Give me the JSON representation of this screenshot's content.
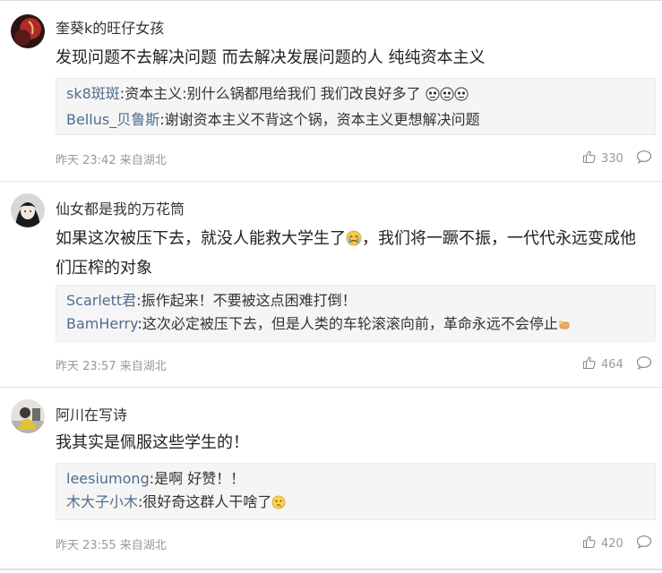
{
  "comments": [
    {
      "username": "奎葵k的旺仔女孩",
      "avatar_icon": "avatar-dark-red",
      "content": "发现问题不去解决问题 而去解决发展问题的人 纯纯资本主义",
      "replies": [
        {
          "user": "sk8斑斑",
          "sep": ":",
          "text": "资本主义:别什么锅都甩给我们 我们改良好多了",
          "emoji": [
            "disapproval-face-icon",
            "disapproval-face-icon",
            "disapproval-face-icon"
          ]
        },
        {
          "user": "Bellus_贝鲁斯",
          "sep": ":",
          "text": "谢谢资本主义不背这个锅，资本主义更想解决问题",
          "emoji": []
        }
      ],
      "time": "昨天 23:42",
      "location": "来自湖北",
      "likes": "330"
    },
    {
      "username": "仙女都是我的万花筒",
      "avatar_icon": "avatar-anime-girl",
      "content_parts": [
        "如果这次被压下去，就没人能救大学生了",
        "，我们将一蹶不振，一代代永远变成他们压榨的对象"
      ],
      "content_emoji": "crying-face-icon",
      "replies": [
        {
          "user": "Scarlett君",
          "sep": ":",
          "text": "振作起来！不要被这点困难打倒！",
          "emoji": []
        },
        {
          "user": "BamHerry",
          "sep": ":",
          "text": "这次必定被压下去，但是人类的车轮滚滚向前，革命永远不会停止",
          "emoji": [
            "fist-icon"
          ]
        }
      ],
      "time": "昨天 23:57",
      "location": "来自湖北",
      "likes": "464"
    },
    {
      "username": "阿川在写诗",
      "avatar_icon": "avatar-photo",
      "content": "我其实是佩服这些学生的！",
      "replies": [
        {
          "user": "leesiumong",
          "sep": ":",
          "text": "是啊 好赞！！",
          "emoji": []
        },
        {
          "user": "木大子小木",
          "sep": ":",
          "text": "很好奇这群人干啥了",
          "emoji": [
            "thinking-face-icon"
          ]
        }
      ],
      "time": "昨天 23:55",
      "location": "来自湖北",
      "likes": "420"
    }
  ],
  "colors": {
    "reply_user": "#4f6d8f",
    "meta": "#999999",
    "reply_bg": "#f5f5f5"
  }
}
